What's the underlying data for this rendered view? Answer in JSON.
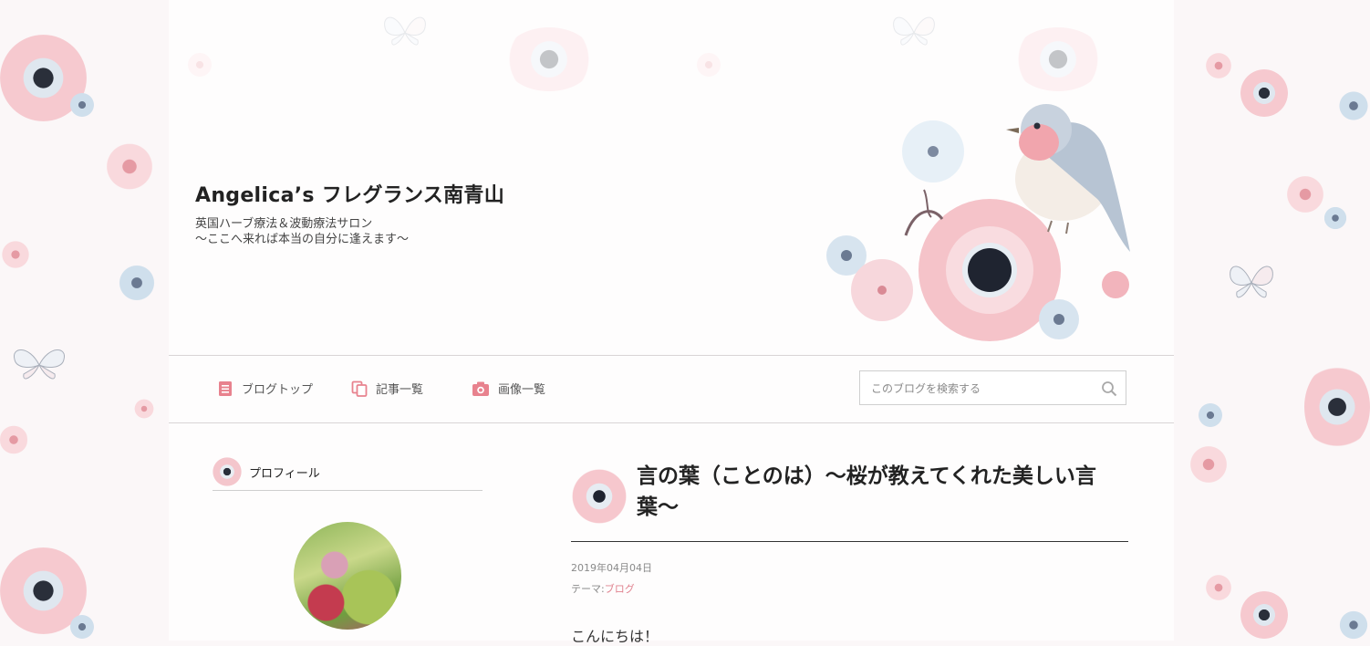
{
  "blog": {
    "title": "Angelica’s フレグランス南青山",
    "description_line1": "英国ハーブ療法＆波動療法サロン",
    "description_line2": "〜ここへ来れば本当の自分に逢えます〜"
  },
  "nav": {
    "items": [
      {
        "label": "ブログトップ",
        "icon": "document-icon"
      },
      {
        "label": "記事一覧",
        "icon": "copy-icon"
      },
      {
        "label": "画像一覧",
        "icon": "camera-icon"
      }
    ],
    "search_placeholder": "このブログを検索する"
  },
  "sidebar": {
    "profile_heading": "プロフィール"
  },
  "article": {
    "title": "言の葉（ことのは）〜桜が教えてくれた美しい言葉〜",
    "date": "2019年04月04日",
    "theme_label": "テーマ:",
    "theme_value": "ブログ",
    "body_first_line": "こんにちは！"
  },
  "colors": {
    "accent_pink": "#e0828f",
    "icon_pink": "#e8828e",
    "text_dark": "#222222",
    "divider": "#d9d4d6"
  }
}
